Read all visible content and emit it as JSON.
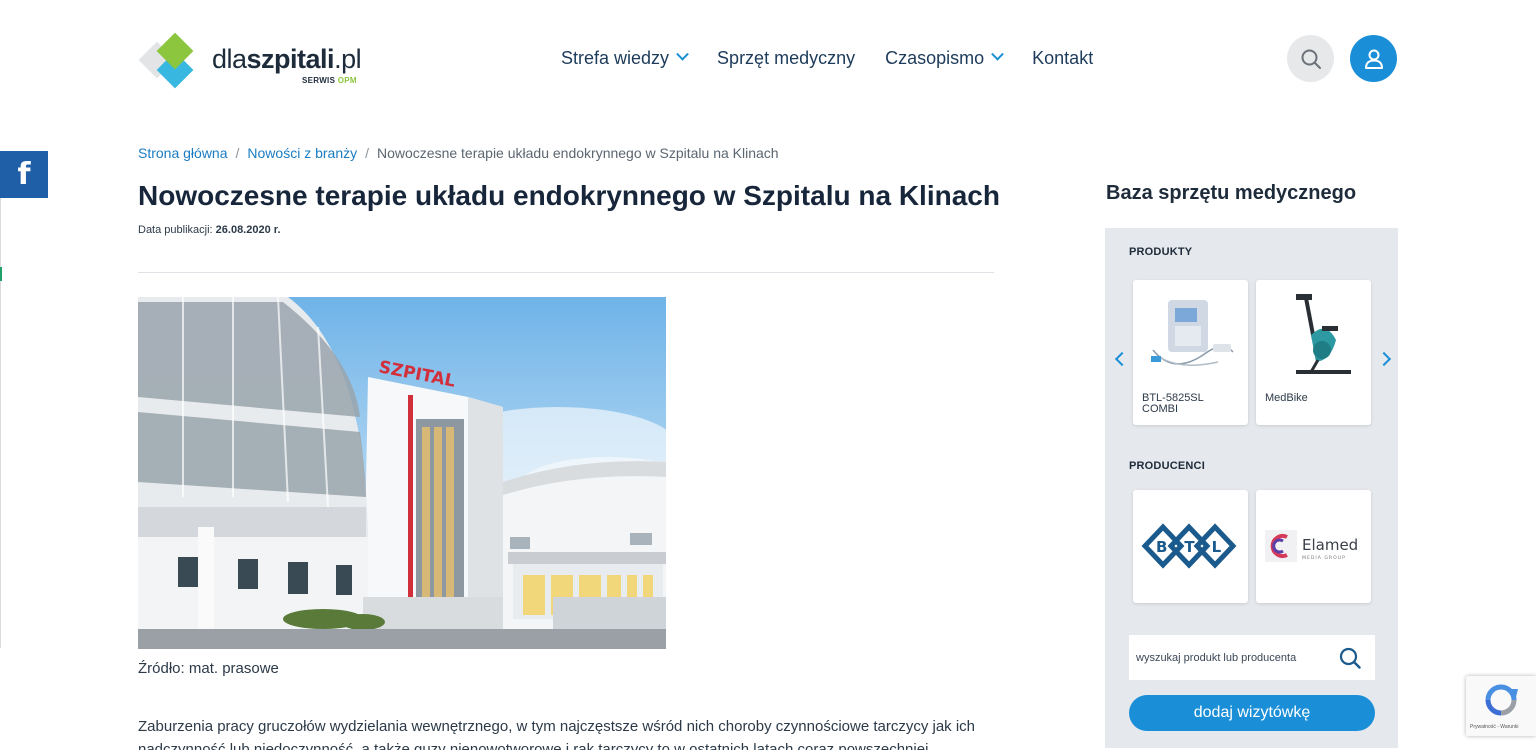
{
  "header": {
    "logo": {
      "text_regular": "dla",
      "text_bold": "szpitali",
      "text_suffix": ".pl",
      "sub_prefix": "SERWIS",
      "sub_brand": "OPM"
    },
    "nav": [
      {
        "label": "Strefa wiedzy",
        "dropdown": true
      },
      {
        "label": "Sprzęt medyczny",
        "dropdown": false
      },
      {
        "label": "Czasopismo",
        "dropdown": true
      },
      {
        "label": "Kontakt",
        "dropdown": false
      }
    ]
  },
  "social": {
    "facebook_glyph": "f"
  },
  "breadcrumb": {
    "items": [
      "Strona główna",
      "Nowości z branży"
    ],
    "current": "Nowoczesne terapie układu endokrynnego w Szpitalu na Klinach",
    "separator": "/"
  },
  "article": {
    "title": "Nowoczesne terapie układu endokrynnego w Szpitalu na Klinach",
    "date_label": "Data publikacji: ",
    "date_value": "26.08.2020 r.",
    "photo_sign": "SZPITAL",
    "source": "Źródło: mat. prasowe",
    "body": "Zaburzenia pracy gruczołów wydzielania wewnętrznego, w tym najczęstsze wśród nich choroby czynnościowe tarczycy jak ich nadczynność lub niedoczynność, a także guzy nienowotworowe i rak tarczycy to w ostatnich latach coraz powszechniej"
  },
  "sidebar": {
    "title": "Baza sprzętu medycznego",
    "products_label": "PRODUKTY",
    "products": [
      {
        "name": "BTL-5825SL COMBI"
      },
      {
        "name": "MedBike"
      }
    ],
    "producers_label": "PRODUCENCI",
    "producers": [
      {
        "logo_text": "BTL"
      },
      {
        "logo_text": "Elamed",
        "logo_sub": "MEDIA GROUP"
      }
    ],
    "search": {
      "placeholder": "wyszukaj produkt lub producenta",
      "value": ""
    },
    "add_button": "dodaj wizytówkę"
  },
  "recaptcha": {
    "text": "Prywatność - Warunki"
  },
  "colors": {
    "accent": "#1a8fd8",
    "link": "#1a7cc2",
    "facebook": "#1f5fa8",
    "panel": "#e5e8ec",
    "logo_green": "#8cc63f",
    "logo_blue": "#38b8e0"
  }
}
